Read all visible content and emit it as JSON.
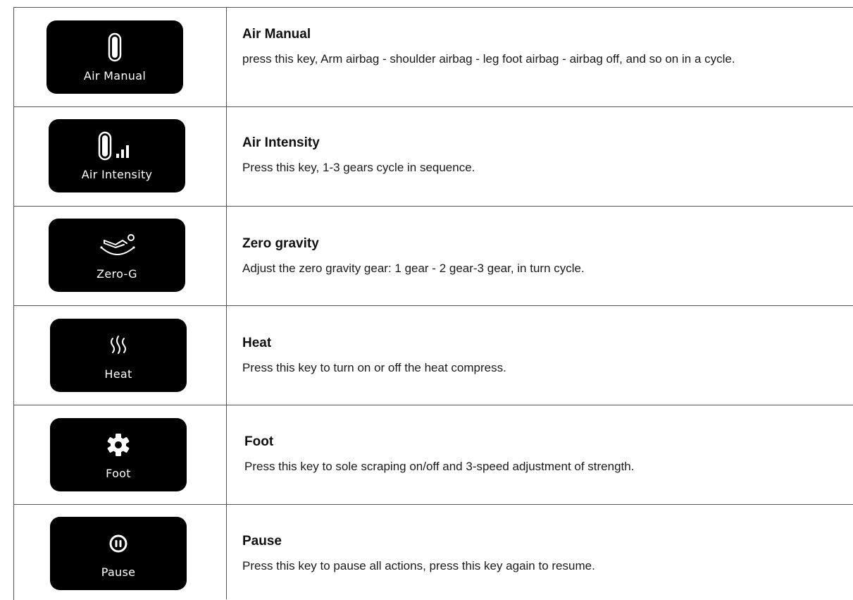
{
  "rows": [
    {
      "key_label": "Air Manual",
      "icon": "airbag-icon",
      "title": "Air Manual",
      "text": "press this key, Arm airbag - shoulder airbag - leg foot airbag - airbag off, and so on in a cycle."
    },
    {
      "key_label": "Air Intensity",
      "icon": "airbag-intensity-icon",
      "title": "Air Intensity",
      "text": "Press this key, 1-3 gears cycle  in sequence."
    },
    {
      "key_label": "Zero-G",
      "icon": "zero-gravity-icon",
      "title": "Zero gravity",
      "text": "Adjust the zero gravity gear: 1 gear - 2 gear-3 gear, in turn cycle."
    },
    {
      "key_label": "Heat",
      "icon": "heat-icon",
      "title": "Heat",
      "text": "Press this key to turn on or off the heat compress."
    },
    {
      "key_label": "Foot",
      "icon": "gear-icon",
      "title": "Foot",
      "text": "Press this key to sole scraping on/off and 3-speed adjustment of strength."
    },
    {
      "key_label": "Pause",
      "icon": "pause-icon",
      "title": "Pause",
      "text": "Press this key to pause all actions, press this key again to resume."
    }
  ]
}
